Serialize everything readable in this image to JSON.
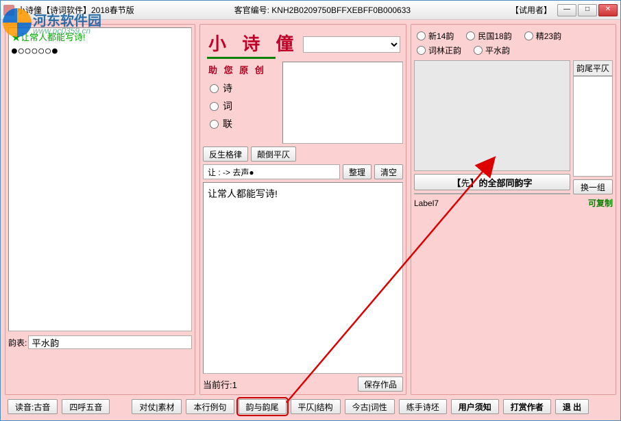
{
  "titlebar": {
    "title": "小诗僮【诗词软件】2018春节版",
    "customer_id_label": "客官编号:",
    "customer_id": "KNH2B0209750BFFXEBFF0B000633",
    "trial": "【试用者】"
  },
  "left": {
    "list_line1": "★让常人都能写诗!",
    "list_line2": "●○○○○○●",
    "yunbiao_label": "韵表:",
    "yunbiao_value": "平水韵"
  },
  "mid": {
    "brand": "小 诗 僮",
    "subtitle": "助 您 原 创",
    "type_options": [
      "诗",
      "词",
      "联"
    ],
    "btn_fansheng": "反生格律",
    "btn_diandao": "颠倒平仄",
    "status_line": "让  : -> 去声●",
    "btn_zhengli": "整理",
    "btn_qingkong": "清空",
    "main_text": "让常人都能写诗!",
    "current_line_label": "当前行:",
    "current_line_value": "1",
    "btn_save": "保存作品"
  },
  "right": {
    "rhyme_options": [
      "新14韵",
      "民国18韵",
      "精23韵",
      "词林正韵",
      "平水韵"
    ],
    "tongyun_prefix": "【",
    "tongyun_char": "先",
    "tongyun_suffix": "】的全部同韵字",
    "yunwei_header": "韵尾平仄",
    "btn_huanyizu": "换一组",
    "label7": "Label7",
    "copyable": "可复制"
  },
  "toolbar": {
    "duyin": "读音:古音",
    "sihu": "四呼五音",
    "duizhang": "对仗|素材",
    "benhang": "本行例句",
    "yunyu": "韵与韵尾",
    "pingze": "平仄|结构",
    "jingu": "今古|词性",
    "lianshou": "练手诗坯",
    "yonghu": "用户须知",
    "dashang": "打赏作者",
    "tuichu": "退 出"
  },
  "watermark": {
    "text1": "河东软件园",
    "text2": "www.pc0359.cn"
  }
}
